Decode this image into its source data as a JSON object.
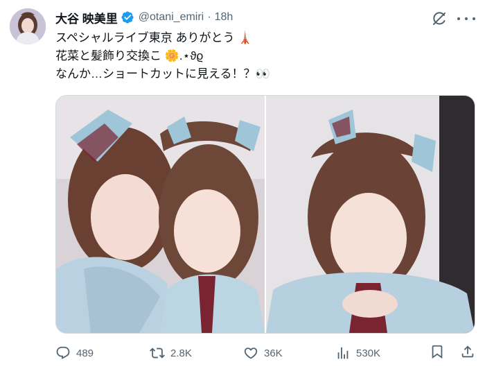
{
  "author": {
    "display_name": "大谷 映美里",
    "handle": "@otani_emiri",
    "dot": "·",
    "time": "18h"
  },
  "tweet": {
    "lines": [
      "スペシャルライブ東京 ありがとう 🗼",
      "花菜と髪飾り交換こ 🌼.⋆ϑϱ",
      "なんか…ショートカットに見える！？👀"
    ]
  },
  "actions": {
    "replies": "489",
    "reposts": "2.8K",
    "likes": "36K",
    "views": "530K"
  },
  "icons": {
    "avatar": "profile-photo",
    "verified": "verified-badge-icon",
    "grok": "grok-icon",
    "more": "more-icon",
    "reply": "reply-icon",
    "repost": "repost-icon",
    "like": "heart-icon",
    "views": "analytics-icon",
    "bookmark": "bookmark-icon",
    "share": "share-icon"
  },
  "colors": {
    "text_primary": "#0f1419",
    "text_secondary": "#536471",
    "verified_blue": "#1d9bf0",
    "border": "#cfd9de"
  }
}
